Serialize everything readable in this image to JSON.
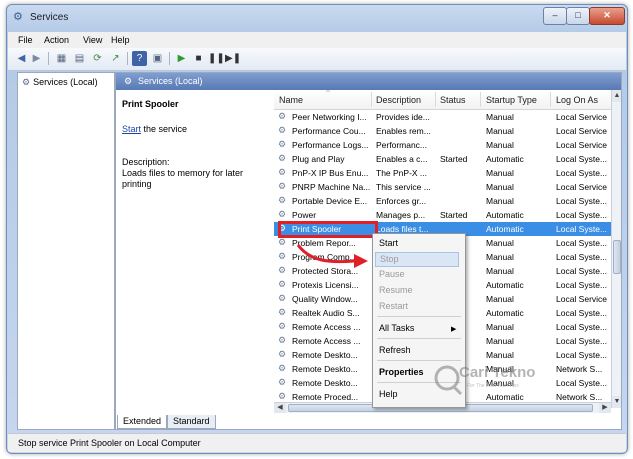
{
  "window": {
    "title": "Services"
  },
  "menu": [
    "File",
    "Action",
    "View",
    "Help"
  ],
  "toolbar": {
    "icons": [
      "back-icon",
      "forward-icon",
      "show-tree-icon",
      "properties-icon",
      "refresh-icon",
      "export-icon",
      "help-icon",
      "console-icon",
      "play-icon",
      "stop-icon",
      "pause-icon",
      "restart-icon"
    ]
  },
  "tree": {
    "root": "Services (Local)"
  },
  "main": {
    "header_title": "Services (Local)",
    "selected_name": "Print Spooler",
    "start_link": "Start",
    "start_suffix": " the service",
    "description_label": "Description:",
    "description_text": "Loads files to memory for later printing"
  },
  "columns": [
    "Name",
    "Description",
    "Status",
    "Startup Type",
    "Log On As"
  ],
  "rows": [
    [
      "Peer Networking I...",
      "Provides ide...",
      "",
      "Manual",
      "Local Service"
    ],
    [
      "Performance Cou...",
      "Enables rem...",
      "",
      "Manual",
      "Local Service"
    ],
    [
      "Performance Logs...",
      "Performanc...",
      "",
      "Manual",
      "Local Service"
    ],
    [
      "Plug and Play",
      "Enables a c...",
      "Started",
      "Automatic",
      "Local Syste..."
    ],
    [
      "PnP-X IP Bus Enu...",
      "The PnP-X ...",
      "",
      "Manual",
      "Local Syste..."
    ],
    [
      "PNRP Machine Na...",
      "This service ...",
      "",
      "Manual",
      "Local Service"
    ],
    [
      "Portable Device E...",
      "Enforces gr...",
      "",
      "Manual",
      "Local Syste..."
    ],
    [
      "Power",
      "Manages p...",
      "Started",
      "Automatic",
      "Local Syste..."
    ],
    [
      "Print Spooler",
      "Loads files t...",
      "",
      "Automatic",
      "Local Syste..."
    ],
    [
      "Problem Repor...",
      "",
      "",
      "Manual",
      "Local Syste..."
    ],
    [
      "Program Comp...",
      "",
      "ed",
      "Manual",
      "Local Syste..."
    ],
    [
      "Protected Stora...",
      "",
      "",
      "Manual",
      "Local Syste..."
    ],
    [
      "Protexis Licensi...",
      "",
      "ed",
      "Automatic",
      "Local Syste..."
    ],
    [
      "Quality Window...",
      "",
      "",
      "Manual",
      "Local Service"
    ],
    [
      "Realtek Audio S...",
      "",
      "ed",
      "Automatic",
      "Local Syste..."
    ],
    [
      "Remote Access ...",
      "",
      "",
      "Manual",
      "Local Syste..."
    ],
    [
      "Remote Access ...",
      "",
      "",
      "Manual",
      "Local Syste..."
    ],
    [
      "Remote Deskto...",
      "",
      "",
      "Manual",
      "Local Syste..."
    ],
    [
      "Remote Deskto...",
      "",
      "",
      "Manual",
      "Network S..."
    ],
    [
      "Remote Deskto...",
      "",
      "",
      "Manual",
      "Local Syste..."
    ],
    [
      "Remote Proced...",
      "",
      "ed",
      "Automatic",
      "Network S..."
    ]
  ],
  "selected_row_index": 8,
  "context_menu": {
    "start": "Start",
    "stop": "Stop",
    "pause": "Pause",
    "resume": "Resume",
    "restart": "Restart",
    "all_tasks": "All Tasks",
    "refresh": "Refresh",
    "properties": "Properties",
    "help": "Help"
  },
  "tabs": [
    "Extended",
    "Standard"
  ],
  "status_bar": "Stop service Print Spooler on Local Computer",
  "watermark": {
    "line1": "Cari Tekno",
    "line2": "For The Best Tech Tips"
  },
  "colors": {
    "selection": "#3a8ee6",
    "highlight_box": "#e11f26",
    "arrow": "#e11f26",
    "header": "#5879b3"
  }
}
